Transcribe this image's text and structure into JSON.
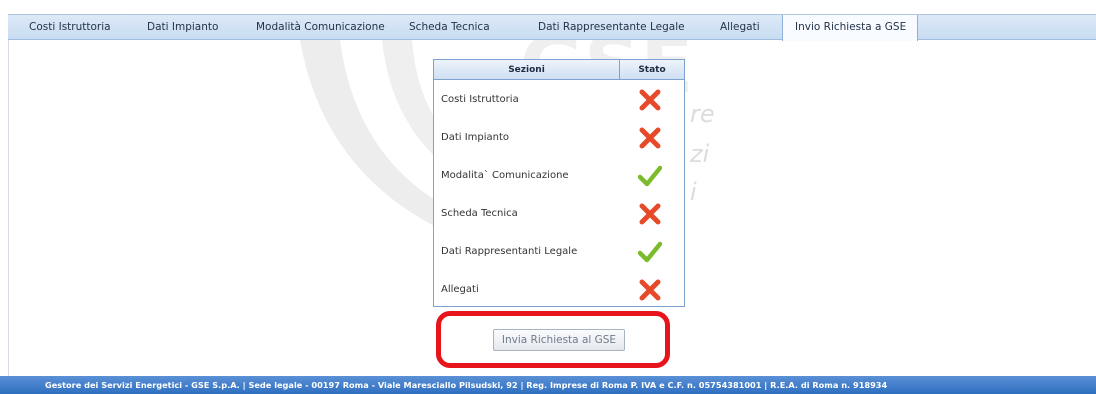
{
  "tabs": [
    {
      "label": "Costi Istruttoria"
    },
    {
      "label": "Dati Impianto"
    },
    {
      "label": "Modalità Comunicazione"
    },
    {
      "label": "Scheda Tecnica"
    },
    {
      "label": "Dati Rappresentante Legale"
    },
    {
      "label": "Allegati"
    },
    {
      "label": "Invio Richiesta a GSE",
      "active": true
    }
  ],
  "table": {
    "header_sections": "Sezioni",
    "header_status": "Stato",
    "rows": [
      {
        "label": "Costi Istruttoria",
        "status": "error"
      },
      {
        "label": "Dati Impianto",
        "status": "error"
      },
      {
        "label": "Modalita` Comunicazione",
        "status": "ok"
      },
      {
        "label": "Scheda Tecnica",
        "status": "error"
      },
      {
        "label": "Dati Rappresentanti Legale",
        "status": "ok"
      },
      {
        "label": "Allegati",
        "status": "error"
      }
    ]
  },
  "actions": {
    "send_label": "Invia Richiesta al GSE"
  },
  "footer": {
    "text": "Gestore dei Servizi Energetici - GSE S.p.A. | Sede legale - 00197 Roma - Viale Maresciallo Pilsudski, 92 | Reg. Imprese di Roma P. IVA e C.F. n. 05754381001 | R.E.A. di Roma n. 918934"
  },
  "watermark": {
    "letters": "GSE",
    "lines": [
      "re",
      "zi",
      "i"
    ]
  },
  "colors": {
    "error": "#e64a2b",
    "ok": "#7cbc2c",
    "highlight": "#e8141b",
    "footer": "#3a78c8"
  }
}
